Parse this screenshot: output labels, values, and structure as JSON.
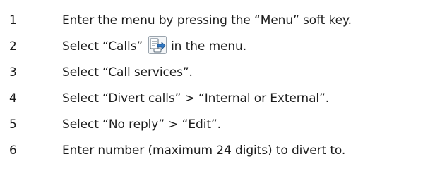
{
  "steps": [
    {
      "number": "1",
      "text": "Enter the menu by pressing the “Menu” soft key."
    },
    {
      "number": "2",
      "text_before": "Select “Calls”",
      "icon": "calls-menu-icon",
      "text_after": "in the menu."
    },
    {
      "number": "3",
      "text": "Select “Call services”."
    },
    {
      "number": "4",
      "text": "Select “Divert calls” > “Internal or External”."
    },
    {
      "number": "5",
      "text": "Select “No reply” > “Edit”."
    },
    {
      "number": "6",
      "text": "Enter number (maximum 24 digits) to divert to."
    }
  ]
}
